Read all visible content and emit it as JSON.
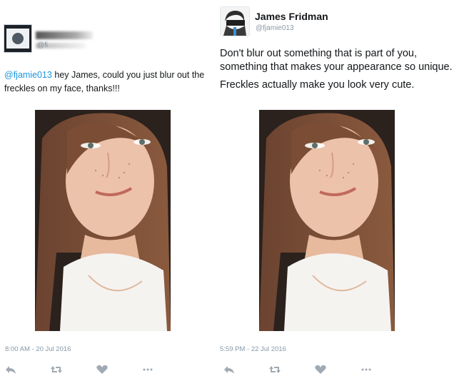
{
  "original_tweet": {
    "handle_visible": "@fi",
    "text_mention": "@fjamie013",
    "text_body": " hey James, could you just blur out the freckles on my face, thanks!!!",
    "timestamp": "8:00 AM - 20 Jul 2016"
  },
  "reply_tweet": {
    "author_name": "James Fridman",
    "author_handle": "@fjamie013",
    "paragraph_1": "Don't blur out something that is part of you, something that makes your appearance so unique.",
    "paragraph_2": "Freckles actually make you look very cute.",
    "timestamp": "5:59 PM - 22 Jul 2016"
  },
  "icons": {
    "reply": "reply-icon",
    "retweet": "retweet-icon",
    "like": "heart-icon",
    "more": "more-icon"
  },
  "colors": {
    "link": "#1b95e0",
    "muted": "#8899a6",
    "text": "#14171a"
  }
}
